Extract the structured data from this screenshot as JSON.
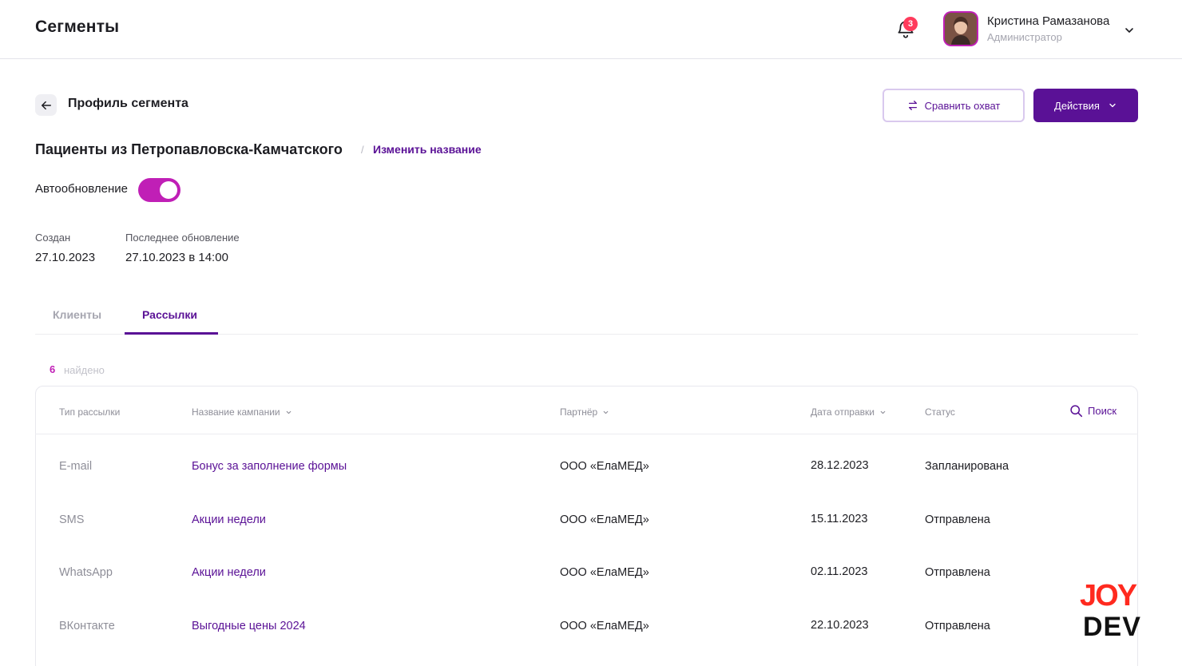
{
  "header": {
    "app_title": "Сегменты",
    "notifications_count": "3",
    "user_name": "Кристина Рамазанова",
    "user_role": "Администратор"
  },
  "page": {
    "title": "Профиль сегмента",
    "compare_label": "Сравнить охват",
    "actions_label": "Действия"
  },
  "segment": {
    "name": "Пациенты из Петропавловска-Камчатского",
    "separator": "/",
    "rename_label": "Изменить название",
    "auto_update_label": "Автообновление",
    "auto_update_on": true,
    "created_label": "Создан",
    "created_value": "27.10.2023",
    "updated_label": "Последнее обновление",
    "updated_value": "27.10.2023 в 14:00"
  },
  "tabs": [
    {
      "label": "Клиенты",
      "active": false
    },
    {
      "label": "Рассылки",
      "active": true
    }
  ],
  "results": {
    "count": "6",
    "label": "найдено"
  },
  "table": {
    "columns": [
      "Тип рассылки",
      "Название кампании",
      "Партнёр",
      "Дата отправки",
      "Статус"
    ],
    "search_label": "Поиск",
    "rows": [
      {
        "type": "E-mail",
        "name": "Бонус за заполнение формы",
        "partner": "ООО «ЕлаМЕД»",
        "date": "28.12.2023",
        "status": "Запланирована"
      },
      {
        "type": "SMS",
        "name": "Акции недели",
        "partner": "ООО «ЕлаМЕД»",
        "date": "15.11.2023",
        "status": "Отправлена"
      },
      {
        "type": "WhatsApp",
        "name": "Акции недели",
        "partner": "ООО «ЕлаМЕД»",
        "date": "02.11.2023",
        "status": "Отправлена"
      },
      {
        "type": "ВКонтакте",
        "name": "Выгодные цены 2024",
        "partner": "ООО «ЕлаМЕД»",
        "date": "22.10.2023",
        "status": "Отправлена"
      }
    ]
  },
  "watermark": {
    "line1": "JOY",
    "line2": "DEV"
  },
  "colors": {
    "accent": "#5a1196",
    "toggle": "#c01fb6",
    "badge": "#ff3b5c",
    "logo_red": "#ff2a1f"
  }
}
